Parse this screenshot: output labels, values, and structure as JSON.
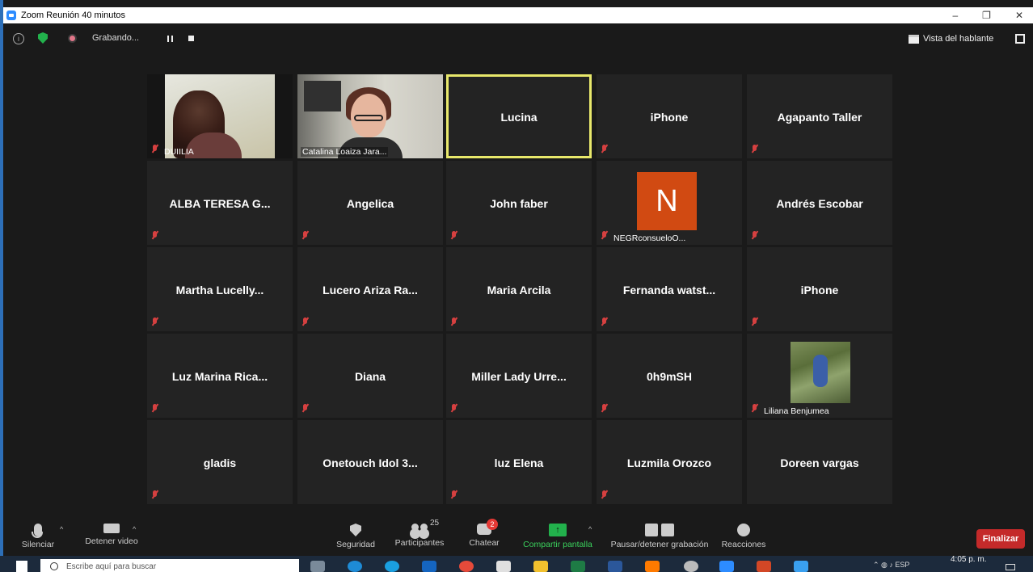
{
  "window": {
    "title": "Zoom Reunión 40 minutos",
    "controls": [
      "–",
      "❐",
      "✕"
    ]
  },
  "topbar": {
    "recording_label": "Grabando...",
    "view_label": "Vista del hablante"
  },
  "tiles": [
    {
      "name": "DUIILIA",
      "type": "video",
      "label_on_video": true
    },
    {
      "name": "Catalina Loaiza Jara...",
      "type": "video",
      "label_on_video": true
    },
    {
      "name": "Lucina",
      "type": "name",
      "active": true
    },
    {
      "name": "iPhone",
      "type": "name"
    },
    {
      "name": "Agapanto Taller",
      "type": "name"
    },
    {
      "name": "ALBA TERESA G...",
      "type": "name"
    },
    {
      "name": "Angelica",
      "type": "name"
    },
    {
      "name": "John faber",
      "type": "name"
    },
    {
      "name": "NEGRconsueloO...",
      "type": "avatar",
      "initial": "N"
    },
    {
      "name": "Andrés Escobar",
      "type": "name"
    },
    {
      "name": "Martha Lucelly...",
      "type": "name"
    },
    {
      "name": "Lucero Ariza Ra...",
      "type": "name"
    },
    {
      "name": "Maria Arcila",
      "type": "name"
    },
    {
      "name": "Fernanda watst...",
      "type": "name"
    },
    {
      "name": "iPhone",
      "type": "name"
    },
    {
      "name": "Luz Marina Rica...",
      "type": "name"
    },
    {
      "name": "Diana",
      "type": "name"
    },
    {
      "name": "Miller Lady Urre...",
      "type": "name"
    },
    {
      "name": "0h9mSH",
      "type": "name"
    },
    {
      "name": "Liliana Benjumea",
      "type": "photo"
    },
    {
      "name": "gladis",
      "type": "name"
    },
    {
      "name": "Onetouch Idol 3...",
      "type": "name"
    },
    {
      "name": "luz Elena",
      "type": "name"
    },
    {
      "name": "Luzmila Orozco",
      "type": "name"
    },
    {
      "name": "Doreen vargas",
      "type": "name"
    }
  ],
  "controls": {
    "mute": "Silenciar",
    "stop_video": "Detener video",
    "security": "Seguridad",
    "participants": "Participantes",
    "participants_count": "25",
    "chat": "Chatear",
    "chat_badge": "2",
    "share": "Compartir pantalla",
    "pause_record": "Pausar/detener grabación",
    "reactions": "Reacciones",
    "end": "Finalizar"
  },
  "taskbar": {
    "search_placeholder": "Escribe aquí para buscar",
    "lang": "ESP",
    "time": "4:05 p. m."
  },
  "colors": {
    "active_speaker": "#e8e86b",
    "end_button": "#c42a2a",
    "share_green": "#22b14c",
    "avatar_orange": "#d14a12"
  }
}
